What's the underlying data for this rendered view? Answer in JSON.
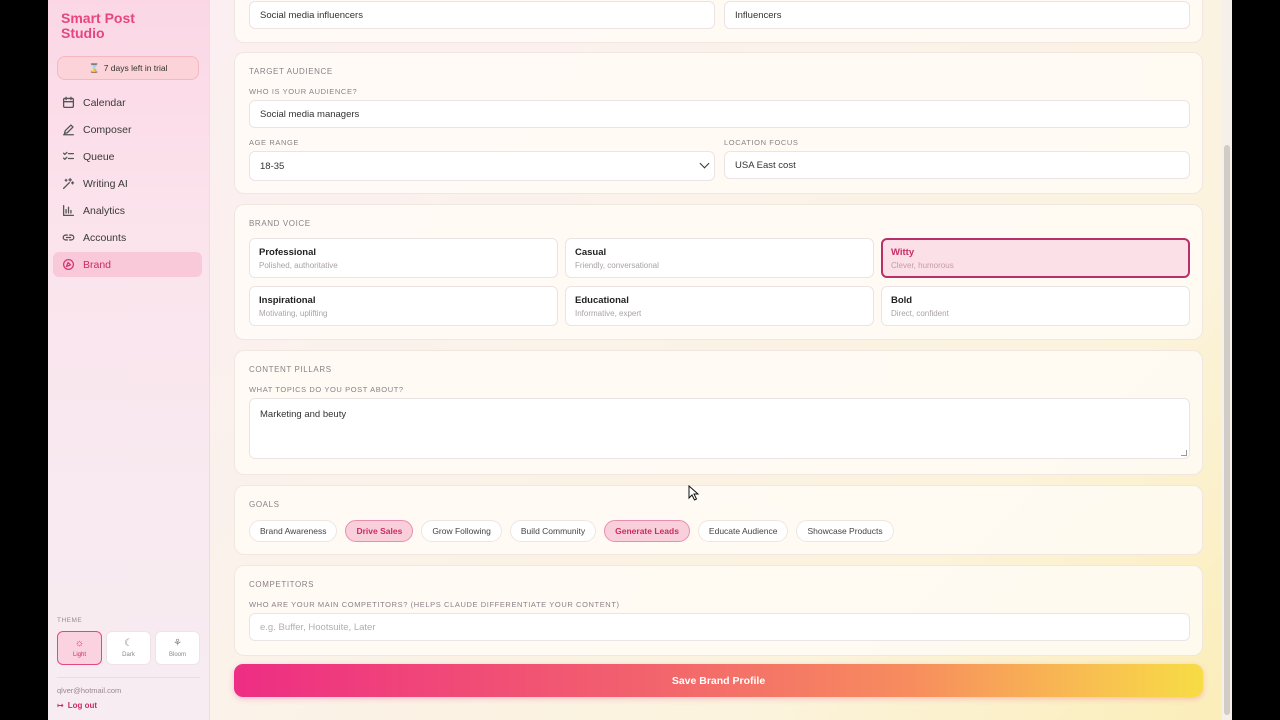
{
  "sidebar": {
    "app_title": "Smart Post Studio",
    "trial_text": "7 days left in trial",
    "items": [
      {
        "label": "Calendar",
        "icon": "calendar-icon"
      },
      {
        "label": "Composer",
        "icon": "pen-icon"
      },
      {
        "label": "Queue",
        "icon": "list-check-icon"
      },
      {
        "label": "Writing AI",
        "icon": "sparkles-icon"
      },
      {
        "label": "Analytics",
        "icon": "bar-chart-icon"
      },
      {
        "label": "Accounts",
        "icon": "link-icon"
      },
      {
        "label": "Brand",
        "icon": "palette-icon",
        "active": true
      }
    ],
    "theme_label": "THEME",
    "themes": [
      {
        "label": "Light",
        "icon": "sun-icon",
        "active": true
      },
      {
        "label": "Dark",
        "icon": "moon-icon"
      },
      {
        "label": "Bloom",
        "icon": "flower-icon"
      }
    ],
    "user_email": "qlver@hotmail.com",
    "logout_label": "Log out"
  },
  "top_fields": {
    "left_value": "Social media influencers",
    "right_value": "Influencers"
  },
  "target_audience": {
    "section_label": "TARGET AUDIENCE",
    "audience_label": "WHO IS YOUR AUDIENCE?",
    "audience_value": "Social media managers",
    "age_label": "AGE RANGE",
    "age_value": "18-35",
    "location_label": "LOCATION FOCUS",
    "location_value": "USA East cost"
  },
  "brand_voice": {
    "section_label": "BRAND VOICE",
    "options": [
      {
        "title": "Professional",
        "desc": "Polished, authoritative"
      },
      {
        "title": "Casual",
        "desc": "Friendly, conversational"
      },
      {
        "title": "Witty",
        "desc": "Clever, humorous",
        "active": true
      },
      {
        "title": "Inspirational",
        "desc": "Motivating, uplifting"
      },
      {
        "title": "Educational",
        "desc": "Informative, expert"
      },
      {
        "title": "Bold",
        "desc": "Direct, confident"
      }
    ]
  },
  "content_pillars": {
    "section_label": "CONTENT PILLARS",
    "topics_label": "WHAT TOPICS DO YOU POST ABOUT?",
    "topics_value": "Marketing and beuty"
  },
  "goals": {
    "section_label": "GOALS",
    "chips": [
      {
        "label": "Brand Awareness"
      },
      {
        "label": "Drive Sales",
        "active": true
      },
      {
        "label": "Grow Following"
      },
      {
        "label": "Build Community"
      },
      {
        "label": "Generate Leads",
        "active": true
      },
      {
        "label": "Educate Audience"
      },
      {
        "label": "Showcase Products"
      }
    ]
  },
  "competitors": {
    "section_label": "COMPETITORS",
    "question_label": "WHO ARE YOUR MAIN COMPETITORS? (HELPS CLAUDE DIFFERENTIATE YOUR CONTENT)",
    "placeholder": "e.g. Buffer, Hootsuite, Later"
  },
  "save_label": "Save Brand Profile",
  "colors": {
    "accent": "#e5467f",
    "active_border": "#b8306a"
  }
}
